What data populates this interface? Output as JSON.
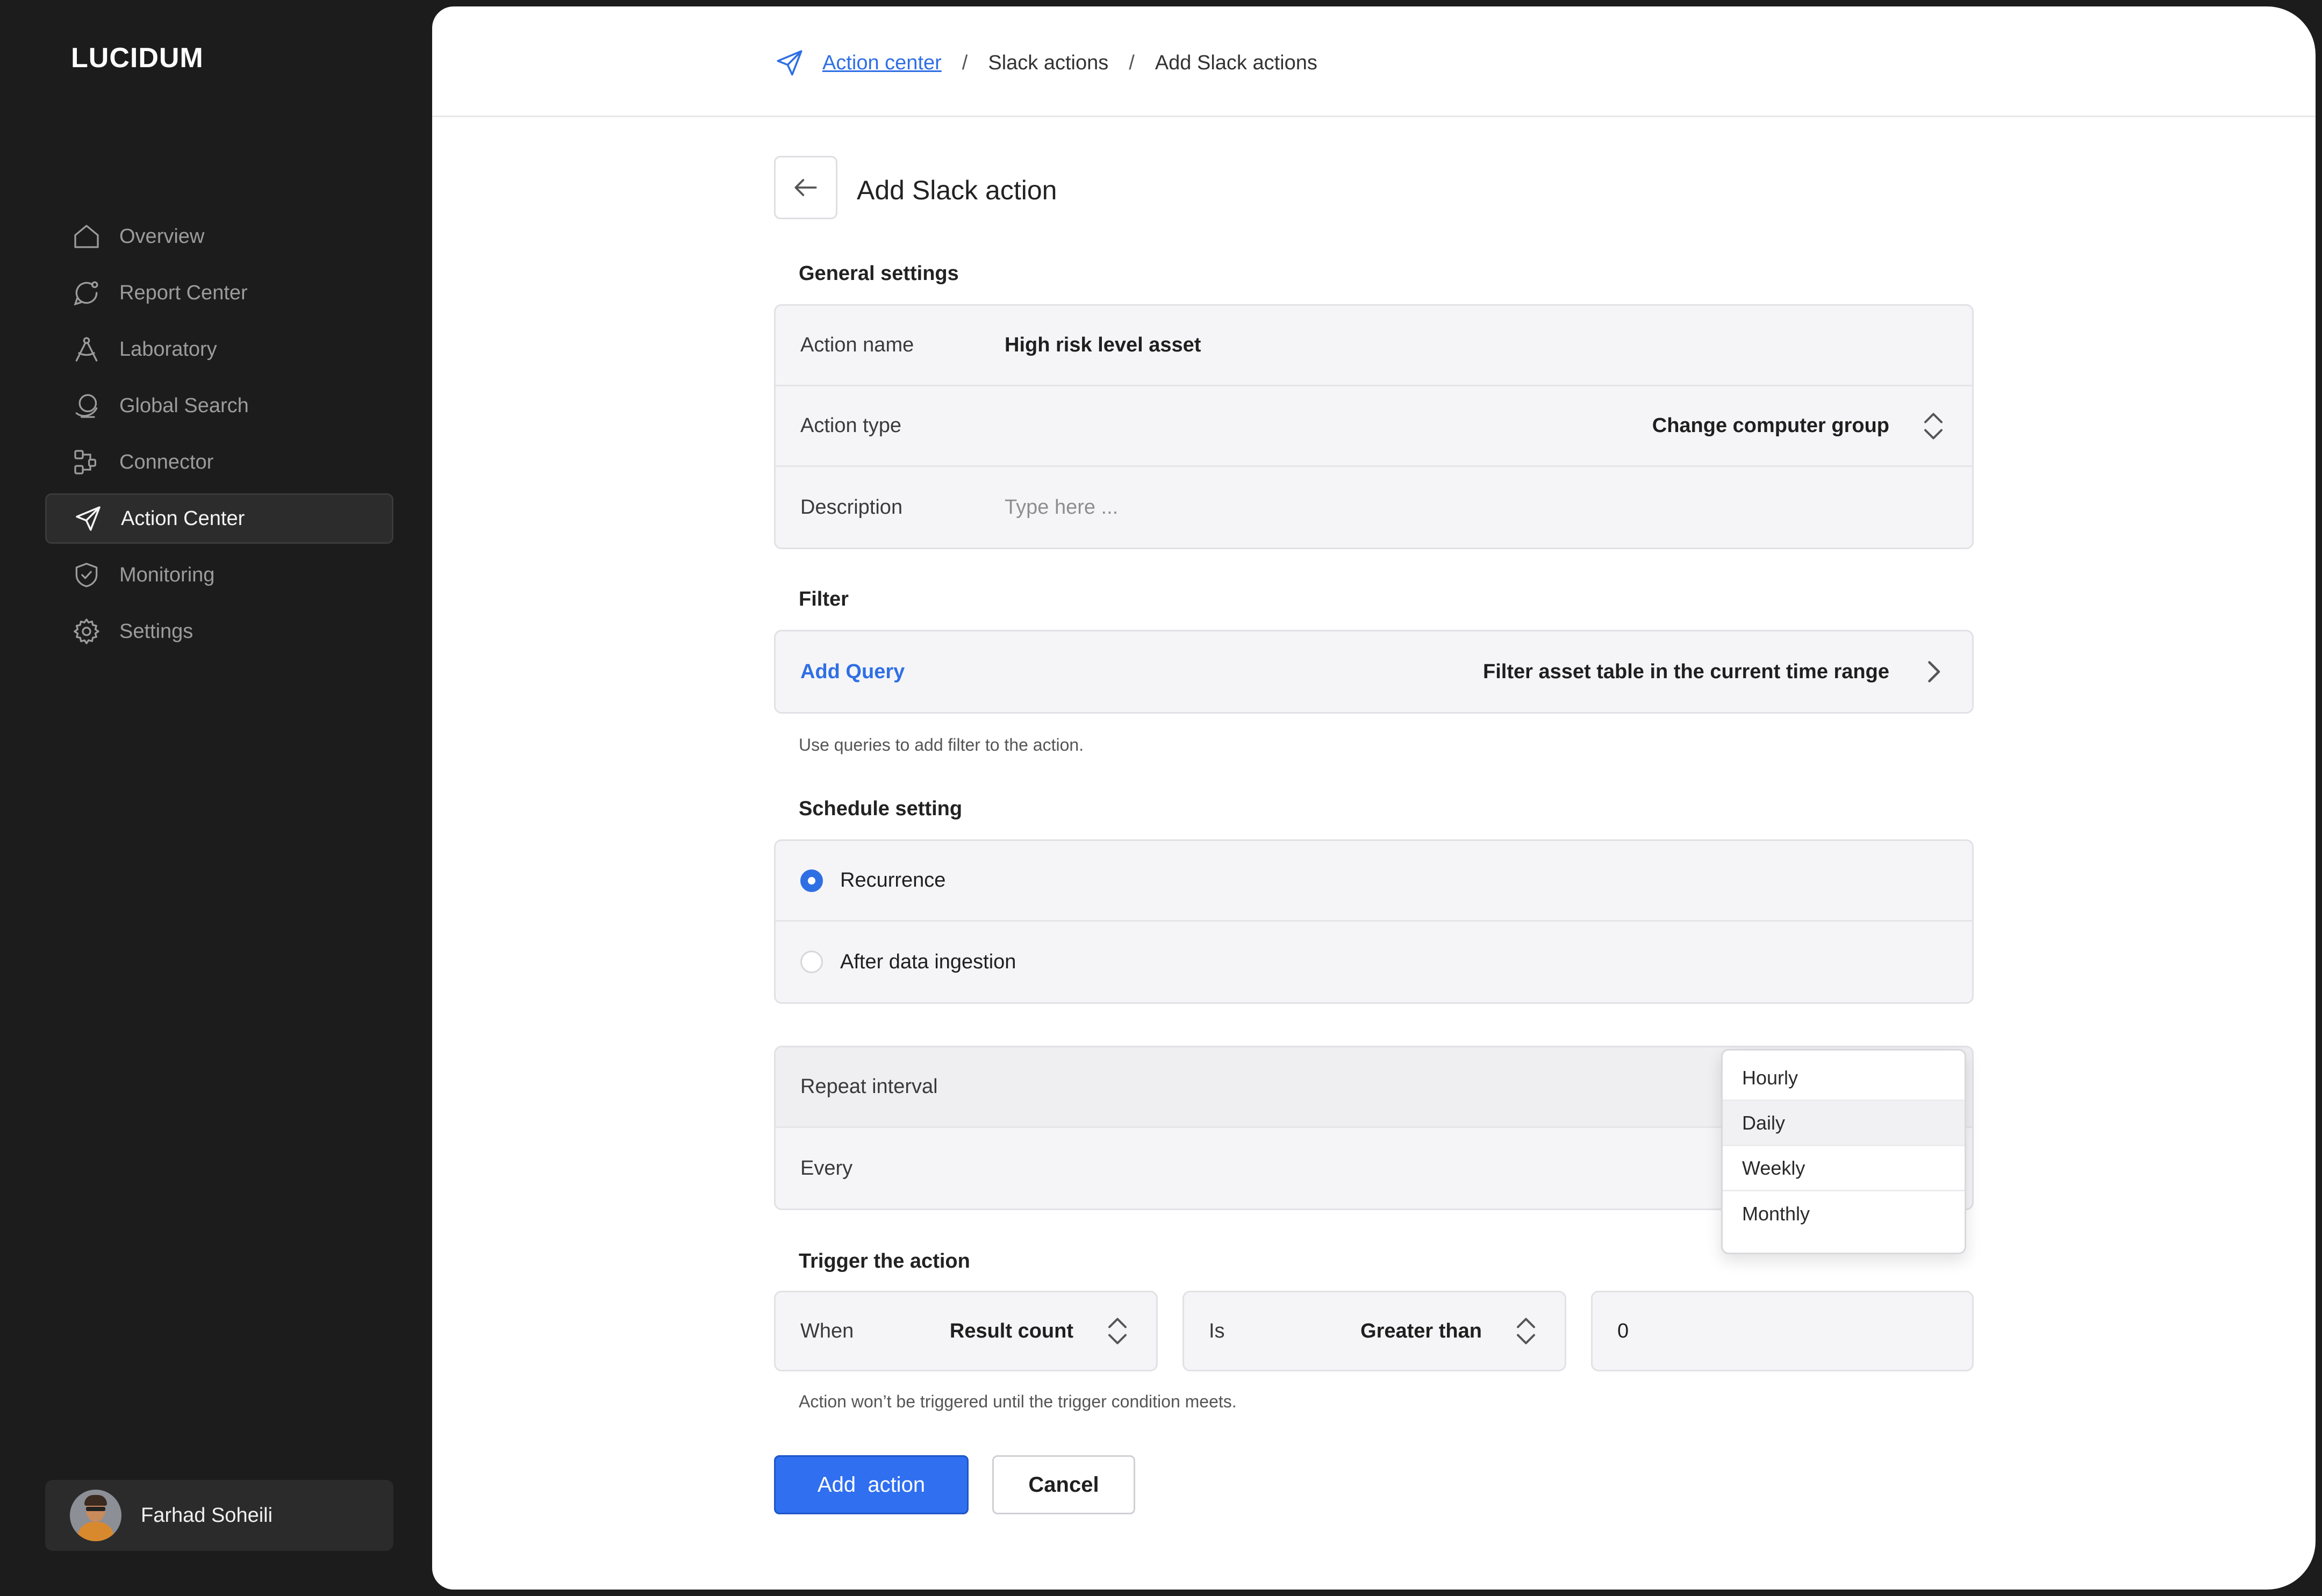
{
  "app": {
    "logo": "LUCIDUM"
  },
  "sidebar": {
    "items": [
      {
        "label": "Overview",
        "icon": "home-icon"
      },
      {
        "label": "Report Center",
        "icon": "chat-icon"
      },
      {
        "label": "Laboratory",
        "icon": "compass-icon"
      },
      {
        "label": "Global Search",
        "icon": "globe-search-icon"
      },
      {
        "label": "Connector",
        "icon": "connector-icon"
      },
      {
        "label": "Action Center",
        "icon": "send-icon",
        "active": true
      },
      {
        "label": "Monitoring",
        "icon": "shield-icon"
      },
      {
        "label": "Settings",
        "icon": "gear-icon"
      }
    ],
    "user": {
      "name": "Farhad Soheili"
    }
  },
  "breadcrumb": {
    "items": [
      "Action center",
      "Slack actions",
      "Add Slack actions"
    ],
    "separator": "/"
  },
  "page": {
    "title": "Add Slack action"
  },
  "general": {
    "title": "General settings",
    "action_name_label": "Action name",
    "action_name_value": "High risk level asset",
    "action_type_label": "Action type",
    "action_type_value": "Change computer group",
    "description_label": "Description",
    "description_placeholder": "Type here ..."
  },
  "filter": {
    "title": "Filter",
    "add_query": "Add Query",
    "filter_value": "Filter asset table in the current time range",
    "hint": "Use queries to add filter to the action."
  },
  "schedule": {
    "title": "Schedule setting",
    "options": [
      "Recurrence",
      "After data ingestion"
    ],
    "selected": "Recurrence",
    "repeat_interval_label": "Repeat interval",
    "every_label": "Every",
    "dropdown_options": [
      "Hourly",
      "Daily",
      "Weekly",
      "Monthly"
    ],
    "dropdown_highlighted": "Daily"
  },
  "trigger": {
    "title": "Trigger the action",
    "when_label": "When",
    "when_value": "Result count",
    "is_label": "Is",
    "is_value": "Greater than",
    "threshold_value": "0",
    "hint": "Action won’t be triggered until the trigger condition meets."
  },
  "actions": {
    "primary": "Add  action",
    "secondary": "Cancel"
  },
  "colors": {
    "accent": "#2f6ff0",
    "sidebar_bg": "#1c1c1c",
    "card_bg": "#f5f5f7"
  }
}
